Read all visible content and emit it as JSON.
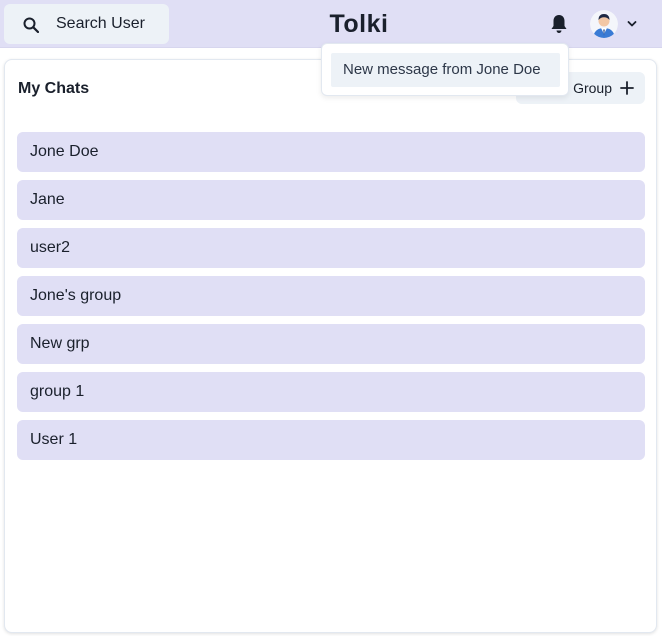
{
  "header": {
    "search_label": "Search User",
    "app_title": "Tolki",
    "icons": {
      "search": "search-icon",
      "notifications": "bell-icon",
      "profile": "avatar",
      "menu_toggle": "chevron-down-icon"
    }
  },
  "notifications": {
    "items": [
      "New message from Jone Doe"
    ]
  },
  "chats": {
    "title": "My Chats",
    "new_group_label": "Group",
    "new_group_icon": "plus-icon",
    "items": [
      {
        "name": "Jone Doe"
      },
      {
        "name": "Jane"
      },
      {
        "name": "user2"
      },
      {
        "name": "Jone's group"
      },
      {
        "name": "New grp"
      },
      {
        "name": "group 1"
      },
      {
        "name": "User 1"
      }
    ]
  },
  "colors": {
    "header_bg": "#e0dff5",
    "chat_item_bg": "#e0dff5",
    "button_bg": "#edf2f7"
  }
}
